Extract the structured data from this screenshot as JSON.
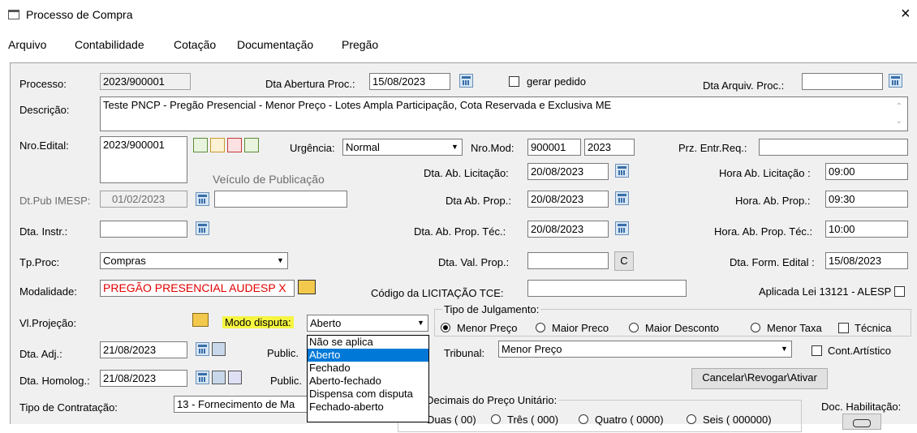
{
  "window": {
    "title": "Processo de Compra",
    "close": "×"
  },
  "menu": [
    "Arquivo",
    "Contabilidade",
    "Cotação",
    "Documentação",
    "Pregão"
  ],
  "form": {
    "processo_label": "Processo:",
    "processo_value": "2023/900001",
    "dta_abertura_label": "Dta Abertura Proc.:",
    "dta_abertura_value": "15/08/2023",
    "gerar_pedido_label": "gerar pedido",
    "dta_arquiv_label": "Dta Arquiv. Proc.:",
    "dta_arquiv_value": "",
    "descricao_label": "Descrição:",
    "descricao_value": "Teste PNCP - Pregão Presencial - Menor Preço - Lotes Ampla Participação, Cota Reservada e Exclusiva ME",
    "nro_edital_label": "Nro.Edital:",
    "nro_edital_value": "2023/900001",
    "urgencia_label": "Urgência:",
    "urgencia_value": "Normal",
    "nro_mod_label": "Nro.Mod:",
    "nro_mod_value": "900001",
    "nro_mod_year": "2023",
    "prz_entr_label": "Prz. Entr.Req.:",
    "prz_entr_value": "",
    "veiculo_label": "Veículo de Publicação",
    "dta_ab_licit_label": "Dta. Ab. Licitação:",
    "dta_ab_licit_value": "20/08/2023",
    "hora_ab_licit_label": "Hora Ab. Licitação :",
    "hora_ab_licit_value": "09:00",
    "dt_pub_imesp_label": "Dt.Pub IMESP:",
    "dt_pub_imesp_value": "01/02/2023",
    "veiculo_value": "",
    "dta_ab_prop_label": "Dta Ab. Prop.:",
    "dta_ab_prop_value": "20/08/2023",
    "hora_ab_prop_label": "Hora. Ab. Prop.:",
    "hora_ab_prop_value": "09:30",
    "dta_instr_label": "Dta. Instr.:",
    "dta_instr_value": "",
    "dta_ab_prop_tec_label": "Dta. Ab. Prop. Téc.:",
    "dta_ab_prop_tec_value": "20/08/2023",
    "hora_ab_prop_tec_label": "Hora. Ab. Prop. Téc.:",
    "hora_ab_prop_tec_value": "10:00",
    "tp_proc_label": "Tp.Proc:",
    "tp_proc_value": "Compras",
    "dta_val_prop_label": "Dta. Val. Prop.:",
    "dta_val_prop_value": "",
    "c_button": "C",
    "dta_form_edital_label": "Dta. Form. Edital :",
    "dta_form_edital_value": "15/08/2023",
    "modalidade_label": "Modalidade:",
    "modalidade_value": "PREGÃO PRESENCIAL AUDESP X",
    "codigo_tce_label": "Código da LICITAÇÃO TCE:",
    "codigo_tce_value": "",
    "aplicada_lei_label": "Aplicada Lei 13121 - ALESP",
    "vl_projecao_label": "Vl.Projeção:",
    "modo_disputa_label": "Modo disputa:",
    "modo_disputa_value": "Aberto",
    "tipo_julgamento_title": "Tipo de Julgamento:",
    "julgamento_options": [
      "Menor Preço",
      "Maior Preco",
      "Maior Desconto",
      "Menor Taxa"
    ],
    "tecnica_label": "Técnica",
    "dta_adj_label": "Dta. Adj.:",
    "dta_adj_value": "21/08/2023",
    "public_label_1": "Public.",
    "tribunal_label": "Tribunal:",
    "tribunal_value": "Menor Preço",
    "cont_artistico_label": "Cont.Artístico",
    "dta_homolog_label": "Dta. Homolog.:",
    "dta_homolog_value": "21/08/2023",
    "public_label_2": "Public.",
    "cancelar_button": "Cancelar\\Revogar\\Ativar",
    "tipo_contratacao_label": "Tipo de Contratação:",
    "tipo_contratacao_value": "13 - Fornecimento de Ma",
    "casas_decimais_title": "asas Decimais do Preço Unitário:",
    "casas_options": [
      "Duas ( 00)",
      "Três ( 000)",
      "Quatro ( 0000)",
      "Seis ( 000000)"
    ],
    "doc_habilitacao_label": "Doc. Habilitação:"
  },
  "modo_disputa_options": [
    "Não se aplica",
    "Aberto",
    "Fechado",
    "Aberto-fechado",
    "Dispensa com disputa",
    "Fechado-aberto"
  ],
  "colors": {
    "highlight": "#f5f542",
    "selection": "#0078d7",
    "modalidade_text": "#e00000"
  }
}
